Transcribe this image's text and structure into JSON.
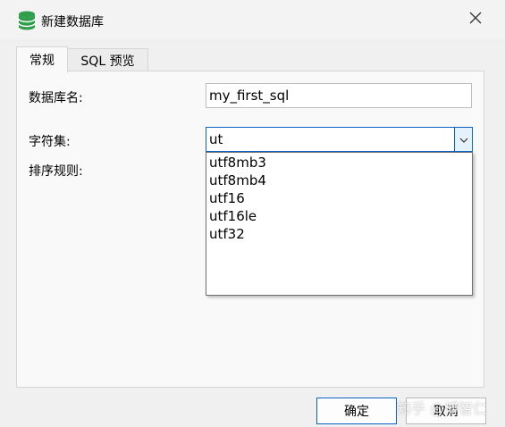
{
  "window": {
    "title": "新建数据库",
    "icon": "database-icon",
    "close_icon": "close-icon"
  },
  "tabs": [
    {
      "label": "常规",
      "active": true
    },
    {
      "label": "SQL 预览",
      "active": false
    }
  ],
  "form": {
    "db_name_label": "数据库名:",
    "db_name_value": "my_first_sql",
    "charset_label": "字符集:",
    "charset_value": "ut",
    "collation_label": "排序规则:"
  },
  "dropdown": {
    "options": [
      "utf8mb3",
      "utf8mb4",
      "utf16",
      "utf16le",
      "utf32"
    ]
  },
  "buttons": {
    "ok": "确定",
    "cancel": "取消"
  },
  "watermark": "知乎 @博智仁",
  "colors": {
    "accent": "#0a64c8",
    "db_icon": "#2e9e4a",
    "panel": "#f9f9f9",
    "window_bg": "#f0f0f0"
  }
}
